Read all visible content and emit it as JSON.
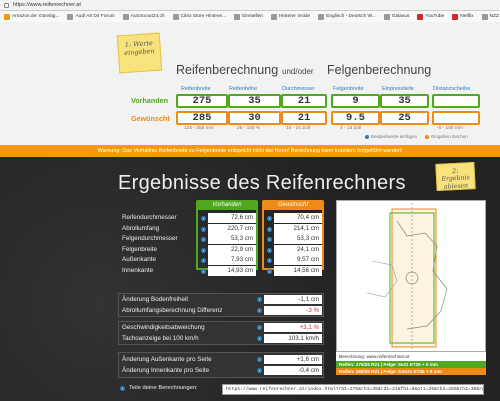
{
  "browser": {
    "url": "https://www.reifenrechner.at",
    "bookmarks": [
      {
        "label": "Amazon.de: Günstig...",
        "icon": "amazon-icon"
      },
      {
        "label": "Audi A8 D4 Forum",
        "icon": "forum-icon"
      },
      {
        "label": "AutoScout24.ch",
        "icon": "autoscout-icon"
      },
      {
        "label": "Citrix Store Hinterei...",
        "icon": "citrix-icon"
      },
      {
        "label": "Einstellen",
        "icon": "folder-icon"
      },
      {
        "label": "Hinterer Inside",
        "icon": "folder-icon"
      },
      {
        "label": "Englisch - Deutsch W...",
        "icon": "dictionary-icon"
      },
      {
        "label": "Galaxus",
        "icon": "galaxus-icon"
      },
      {
        "label": "YouTube",
        "icon": "youtube-icon"
      },
      {
        "label": "Netflix",
        "icon": "netflix-icon"
      },
      {
        "label": "NZZ News - aktuelle...",
        "icon": "nzz-icon"
      }
    ]
  },
  "notes": {
    "sticky1": "1: Werte eingeben",
    "sticky2": "2: Ergebnis ablesen"
  },
  "calc": {
    "title_reifen": "Reifenberechnung",
    "title_oder": "und/oder",
    "title_felgen": "Felgenberechnung",
    "headers": [
      "Reifenbreite",
      "Reifenhöhe",
      "Durchmesser",
      "Felgenbreite",
      "Einpresstiefe",
      "Distanzscheibe"
    ],
    "row_vorhanden": "Vorhanden",
    "row_gewuenscht": "Gewünscht",
    "vorhanden": [
      "275",
      "35",
      "21",
      "9",
      "35",
      ""
    ],
    "gewuenscht": [
      "285",
      "30",
      "21",
      "9.5",
      "25",
      ""
    ],
    "ranges": [
      "125 - 355 mm",
      "25 - 100 %",
      "10 - 24 Zoll",
      "4 - 15 Zoll",
      "-0 - 100 mm"
    ],
    "legend_a": "Beispielwerte einfügen",
    "legend_b": "Eingaben löschen"
  },
  "warning": "Warnung: Das Verhältnis Reifenbreite zu Felgenbreite entspricht nicht der Norm! Berechnung kann trotzdem fortgeführt werden!",
  "results": {
    "title": "Ergebnisse des Reifenrechners",
    "col_vorhanden": "Vorhanden",
    "col_gewuenscht": "Gewünscht",
    "rows": [
      {
        "label": "Reifendurchmesser",
        "v": "72,6 cm",
        "g": "70,4 cm"
      },
      {
        "label": "Abrollumfang",
        "v": "220,7 cm",
        "g": "214,1 cm"
      },
      {
        "label": "Felgendurchmesser",
        "v": "53,3 cm",
        "g": "53,3 cm"
      },
      {
        "label": "Felgenbreite",
        "v": "22,9 cm",
        "g": "24,1 cm"
      },
      {
        "label": "Außenkante",
        "v": "7,93 cm",
        "g": "9,57 cm"
      },
      {
        "label": "Innenkante",
        "v": "14,93 cm",
        "g": "14,56 cm"
      }
    ]
  },
  "compare": {
    "box1": [
      {
        "label": "Änderung Bodenfreiheit",
        "value": "-1,1 cm",
        "red": false
      },
      {
        "label": "Abrollumfangsberechnung Differenz",
        "value": "-3 %",
        "red": true
      }
    ],
    "box2": [
      {
        "label": "Geschwindigkeitsabweichung",
        "value": "+3,1 %",
        "red": true
      },
      {
        "label": "Tachoanzeige bei 100 km/h",
        "value": "103,1 km/h",
        "red": false
      }
    ],
    "box3": [
      {
        "label": "Änderung Außenkante pro Seite",
        "value": "+1,6 cm",
        "red": false
      },
      {
        "label": "Änderung Innenkante pro Seite",
        "value": "-0,4 cm",
        "red": false
      }
    ]
  },
  "diagram": {
    "credit": "Berechnung: www.reifenrechner.at",
    "line1": "Reifen: 275/35 R21 | Felge: 9x21 ET35 + 0 mm",
    "line2": "Reifen: 285/30 R21 | Felge: 9,5x21 ET25 + 0 mm"
  },
  "share": {
    "label": "Teile deine Berechnungen:",
    "url": "https://www.reifenrechner.at/index.html?rb1=275&rh1=35&rd1=21&fb1=9&et1=35&rb2=285&rh2=30&rd2=21&fb2=9.5&et2=25"
  },
  "colors": {
    "green": "#4fa81e",
    "orange": "#ee8a16",
    "blue": "#2e7db5",
    "red": "#d8262b"
  }
}
